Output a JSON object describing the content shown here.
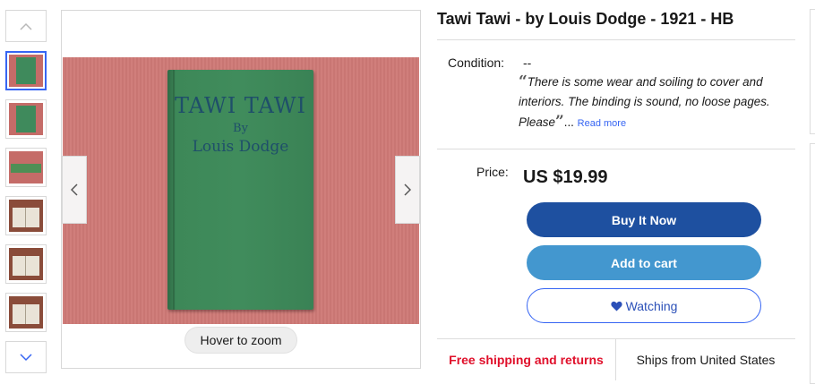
{
  "listing": {
    "title": "Tawi Tawi - by Louis Dodge - 1921 - HB"
  },
  "gallery": {
    "thumbnails": [
      {
        "kind": "cover",
        "active": true
      },
      {
        "kind": "cover",
        "active": false
      },
      {
        "kind": "spine",
        "active": false
      },
      {
        "kind": "open",
        "active": false
      },
      {
        "kind": "open",
        "active": false
      },
      {
        "kind": "open",
        "active": false
      }
    ],
    "main_image": {
      "book_title": "TAWI TAWI",
      "book_by": "By",
      "book_author": "Louis Dodge"
    },
    "zoom_hint": "Hover to zoom",
    "icons": {
      "up": "chevron-up-icon",
      "down": "chevron-down-icon",
      "prev": "chevron-left-icon",
      "next": "chevron-right-icon"
    }
  },
  "condition": {
    "label": "Condition:",
    "value": "--",
    "quote": "There is some wear and soiling to cover and interiors. The binding is sound, no loose pages. Please",
    "ellipsis": "...",
    "read_more": "Read more"
  },
  "price": {
    "label": "Price:",
    "value": "US $19.99"
  },
  "actions": {
    "buy_now": "Buy It Now",
    "add_to_cart": "Add to cart",
    "watching": "Watching"
  },
  "shipping": {
    "free": "Free shipping and returns",
    "origin": "Ships from United States"
  },
  "colors": {
    "buy_now": "#1e50a0",
    "add_to_cart": "#4397cf",
    "accent_blue": "#3665f3",
    "free_shipping_red": "#e0102b"
  }
}
